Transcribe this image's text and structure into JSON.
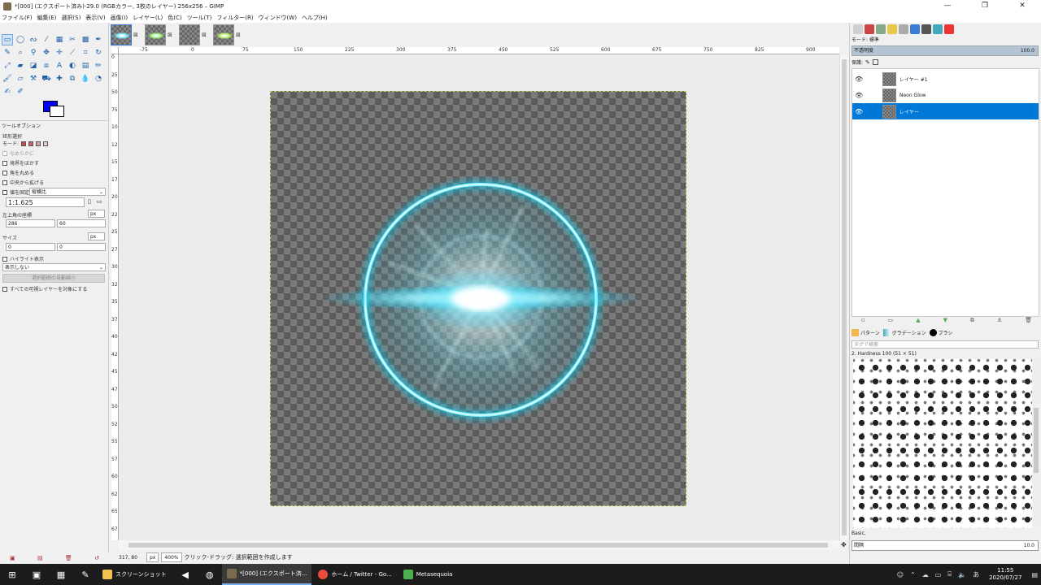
{
  "window": {
    "title": "*[000] (エクスポート済み)-29.0 (RGBカラー, 3枚のレイヤー) 256x256 – GIMP",
    "minimize": "—",
    "maximize": "❐",
    "close": "✕"
  },
  "menu": [
    "ファイル(F)",
    "編集(E)",
    "選択(S)",
    "表示(V)",
    "画像(I)",
    "レイヤー(L)",
    "色(C)",
    "ツール(T)",
    "フィルター(R)",
    "ウィンドウ(W)",
    "ヘルプ(H)"
  ],
  "image_tabs": [
    {
      "glow": "#7fe7ff"
    },
    {
      "glow": "#9ef07a"
    },
    {
      "glow": ""
    },
    {
      "glow": "#b6f06a"
    }
  ],
  "colors": {
    "foreground": "#0000ff",
    "background": "#ffffff",
    "accent": "#0078d7",
    "neon": "#3fe0ff"
  },
  "tool_options": {
    "header": "ツールオプション",
    "tool_name": "矩形選択",
    "mode_label": "モード:",
    "antialias": "なめらかに",
    "feather": "境界をぼかす",
    "rounded": "角を丸める",
    "expand_center": "中央から拡げる",
    "fixed_label": "値を固定",
    "fixed_value": "縦横比",
    "ratio": "1:1.625",
    "position_label": "左上角の座標",
    "position_unit": "px",
    "pos_x": "286",
    "pos_y": "60",
    "size_label": "サイズ",
    "size_unit": "px",
    "size_w": "0",
    "size_h": "0",
    "highlight": "ハイライト表示",
    "guides": "表示しない",
    "auto_shrink": "選択範囲の自動縮小",
    "shrink_merged": "すべての可視レイヤーを対象にする"
  },
  "rulers": {
    "h": [
      "-75",
      "0",
      "75",
      "150",
      "225",
      "300",
      "375",
      "450",
      "525",
      "600",
      "675",
      "750",
      "825",
      "900",
      "975"
    ],
    "v": [
      "0",
      "25",
      "50",
      "75",
      "100",
      "125",
      "150",
      "175",
      "200",
      "225",
      "250",
      "275",
      "300",
      "325",
      "350",
      "375",
      "400",
      "425",
      "450",
      "475",
      "500",
      "525",
      "550",
      "575",
      "600",
      "625",
      "650",
      "675"
    ]
  },
  "status": {
    "coords": "317, 80",
    "unit": "px",
    "zoom": "400%",
    "message": "クリック-ドラッグ: 選択範囲を作成します"
  },
  "layers_panel": {
    "mode_label": "モード: 標準",
    "opacity_label": "不透明度",
    "opacity_value": "100.0",
    "lock_label": "保護:",
    "layers": [
      {
        "name": "レイヤー #1",
        "visible": true,
        "selected": false
      },
      {
        "name": "Neon Glow",
        "visible": true,
        "selected": false
      },
      {
        "name": "レイヤー",
        "visible": true,
        "selected": true
      }
    ]
  },
  "brushes_panel": {
    "tabs": [
      "パターン",
      "グラデーション",
      "ブラシ"
    ],
    "tag_placeholder": "タグで検索",
    "current_brush": "2. Hardness 100 (51 × 51)",
    "preset": "Basic,",
    "spacing_label": "間隔",
    "spacing_value": "10.0"
  },
  "taskbar": {
    "apps": [
      {
        "label": "スクリーンショット",
        "color": "#f2c14e",
        "active": false
      },
      {
        "label": "*[000] (エクスポート済...",
        "color": "#7a6a50",
        "active": true
      },
      {
        "label": "ホーム / Twitter - Go...",
        "color": "#e74c3c",
        "active": false
      },
      {
        "label": "Metasequoia",
        "color": "#4caf50",
        "active": false
      }
    ],
    "time": "11:55",
    "date": "2020/07/27"
  }
}
